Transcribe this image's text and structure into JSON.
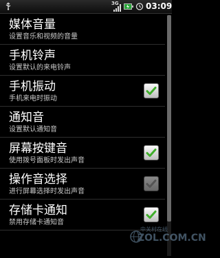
{
  "status_bar": {
    "network": "3G",
    "time": "03:09"
  },
  "settings": [
    {
      "title": "媒体音量",
      "subtitle": "设置音乐和视频的音量",
      "checkbox": null
    },
    {
      "title": "手机铃声",
      "subtitle": "设置默认的来电铃声",
      "checkbox": null
    },
    {
      "title": "手机振动",
      "subtitle": "手机来电时振动",
      "checkbox": "checked"
    },
    {
      "title": "通知音",
      "subtitle": "设置默认通知音",
      "checkbox": null
    },
    {
      "title": "屏幕按键音",
      "subtitle": "使用拨号面板时发出声音",
      "checkbox": "checked"
    },
    {
      "title": "操作音选择",
      "subtitle": "进行屏幕选择时发出声音",
      "checkbox": "checked-dim"
    },
    {
      "title": "存储卡通知",
      "subtitle": "禁用存储卡通知音",
      "checkbox": "checked"
    }
  ],
  "watermark": {
    "text": "中关村在线",
    "logo": "ZOL.COM.CN"
  },
  "colors": {
    "check_green": "#3fae2a",
    "background": "#000000"
  }
}
